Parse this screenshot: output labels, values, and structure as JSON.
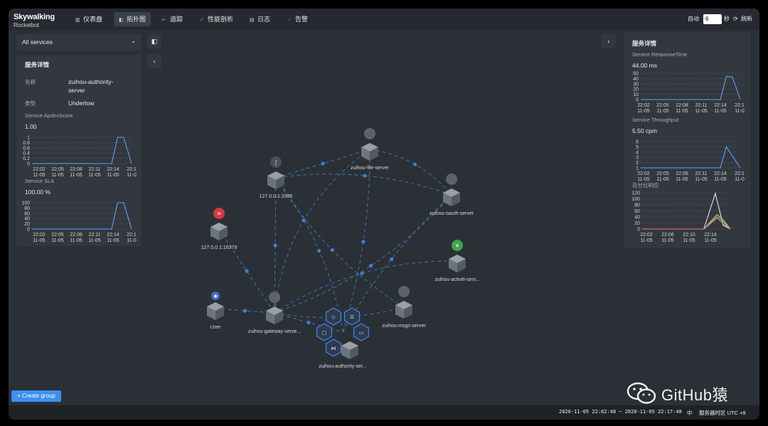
{
  "app": {
    "logo_main": "Skywalking",
    "logo_sub": "Rocketbot"
  },
  "nav": [
    {
      "icon": "dashboard-icon",
      "glyph": "▥",
      "label": "仪表盘"
    },
    {
      "icon": "topology-icon",
      "glyph": "◧",
      "label": "拓扑图",
      "active": true
    },
    {
      "icon": "trace-icon",
      "glyph": "⊢",
      "label": "追踪"
    },
    {
      "icon": "profile-icon",
      "glyph": "⟋",
      "label": "性能剖析"
    },
    {
      "icon": "log-icon",
      "glyph": "▤",
      "label": "日志"
    },
    {
      "icon": "alarm-icon",
      "glyph": "◌",
      "label": "告警"
    }
  ],
  "toolbar": {
    "auto_label": "自动",
    "interval": "6",
    "seconds_label": "秒",
    "refresh_label": "刷新"
  },
  "service_select": {
    "value": "All services"
  },
  "left_panel": {
    "title": "服务详情",
    "name_label": "名称",
    "name_value_1": "zuihou-authority-",
    "name_value_2": "server",
    "type_label": "类型",
    "type_value": "Undertow",
    "apdex": {
      "label": "Service ApdexScore",
      "value": "1.00",
      "yticks": [
        "1",
        "0.8",
        "0.6",
        "0.4",
        "0.2",
        "0"
      ],
      "xticks": [
        "22:02",
        "22:05",
        "22:08",
        "22:11",
        "22:14",
        "22:1"
      ],
      "xsub": [
        "11-05",
        "11-05",
        "11-05",
        "11-05",
        "11-05",
        "11-0"
      ]
    },
    "sla": {
      "label": "Service SLA",
      "value": "100.00 %",
      "yticks": [
        "100",
        "80",
        "60",
        "40",
        "20",
        "0"
      ],
      "xticks": [
        "22:02",
        "22:05",
        "22:08",
        "22:11",
        "22:14",
        "22:1"
      ],
      "xsub": [
        "11-05",
        "11-05",
        "11-05",
        "11-05",
        "11-05",
        "11-0"
      ]
    }
  },
  "right_panel": {
    "title": "服务详情",
    "resp": {
      "label": "Service ResponseTime",
      "value": "44.00 ms",
      "yticks": [
        "50",
        "40",
        "30",
        "20",
        "10",
        "0"
      ],
      "xticks": [
        "22:02",
        "22:05",
        "22:08",
        "22:11",
        "22:14",
        "22:1"
      ],
      "xsub": [
        "11-05",
        "11-05",
        "11-05",
        "11-05",
        "11-05",
        "11-0"
      ]
    },
    "thru": {
      "label": "Service Throughput",
      "value": "5.50 cpm",
      "yticks": [
        "6",
        "5",
        "4",
        "3",
        "2",
        "1"
      ],
      "xticks": [
        "22:02",
        "22:05",
        "22:08",
        "22:11",
        "22:14",
        "22:1"
      ],
      "xsub": [
        "11-05",
        "11-05",
        "11-05",
        "11-05",
        "11-05",
        "11-0"
      ]
    },
    "pct": {
      "label": "百分比响应",
      "yticks": [
        "120",
        "100",
        "80",
        "60",
        "40",
        "20",
        "0"
      ],
      "xticks": [
        "22:02",
        "22:06",
        "22:10",
        "22:14"
      ],
      "xsub": [
        "11-05",
        "11-05",
        "11-05",
        "11-05"
      ]
    }
  },
  "nodes": [
    {
      "id": "file",
      "label": "zuihou-file-server",
      "badge": "grey"
    },
    {
      "id": "mysql",
      "label": "127.0.0.1:3306",
      "badge": "mysql"
    },
    {
      "id": "oauth",
      "label": "zuihou-oauth-server",
      "badge": "grey"
    },
    {
      "id": "redis",
      "label": "127.0.0.1:16379",
      "badge": "redis"
    },
    {
      "id": "activiti",
      "label": "zuihou-activiti-serv...",
      "badge": "spring"
    },
    {
      "id": "user",
      "label": "User",
      "badge": "user"
    },
    {
      "id": "gateway",
      "label": "zuihou-gateway-serve...",
      "badge": "grey"
    },
    {
      "id": "authority",
      "label": "zuihou-authority-ser...",
      "badge": "selected"
    },
    {
      "id": "msgs",
      "label": "zuihou-msgs-server",
      "badge": "grey"
    }
  ],
  "buttons": {
    "create_group": "+ Create group"
  },
  "footer": {
    "time_range": "2020-11-05 22:02:48 ~ 2020-11-05 22:17:48",
    "lang": "中",
    "tz": "服务器时区 UTC +8"
  },
  "watermark": {
    "text": "GitHub猿"
  },
  "colors": {
    "accent": "#3d8ff2",
    "edge": "#3f7fd0",
    "bg": "#2b3036"
  }
}
